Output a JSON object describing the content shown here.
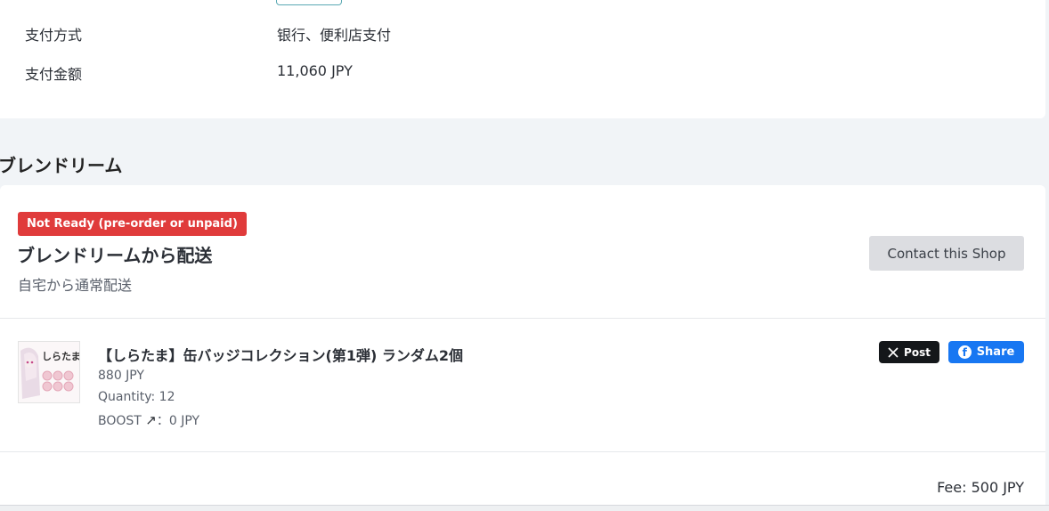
{
  "payment_info": {
    "method_label": "支付方式",
    "method_value": "银行、便利店支付",
    "amount_label": "支付金额",
    "amount_value": "11,060 JPY"
  },
  "shop_section": {
    "heading": "ブレンドリーム",
    "status_badge": "Not Ready (pre-order or unpaid)",
    "shipping_title": "ブレンドリームから配送",
    "shipping_method": "自宅から通常配送",
    "contact_button": "Contact this Shop"
  },
  "item": {
    "title": "【しらたま】缶バッジコレクション(第1弾) ランダム2個",
    "price": "880 JPY",
    "quantity_label": "Quantity:",
    "quantity": "12",
    "boost_label": "BOOST",
    "boost_value": "：0 JPY",
    "thumb_text": "しらたま"
  },
  "share": {
    "x_label": "Post",
    "fb_label": "Share"
  },
  "fee": {
    "label": "Fee:",
    "value": "500 JPY"
  },
  "colors": {
    "status_red": "#e03b3b",
    "facebook_blue": "#1877f2",
    "x_black": "#14171a",
    "page_bg": "#f1f4f7"
  }
}
